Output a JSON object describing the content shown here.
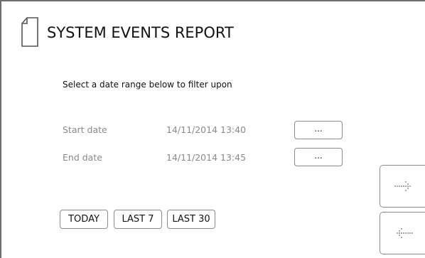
{
  "header": {
    "title": "SYSTEM EVENTS REPORT",
    "icon": "document-icon"
  },
  "instruction": "Select a date range below to filter upon",
  "fields": {
    "start": {
      "label": "Start date",
      "value": "14/11/2014 13:40",
      "button": "..."
    },
    "end": {
      "label": "End date",
      "value": "14/11/2014 13:45",
      "button": "..."
    }
  },
  "quick_ranges": {
    "today": "TODAY",
    "last7": "LAST 7",
    "last30": "LAST 30"
  },
  "nav": {
    "next_icon": "dotted-arrow-right-icon",
    "back_icon": "dotted-arrow-left-icon"
  },
  "colors": {
    "text": "#111111",
    "muted": "#8a8a8a",
    "border": "#8c8c8c",
    "arrow": "#909090"
  }
}
